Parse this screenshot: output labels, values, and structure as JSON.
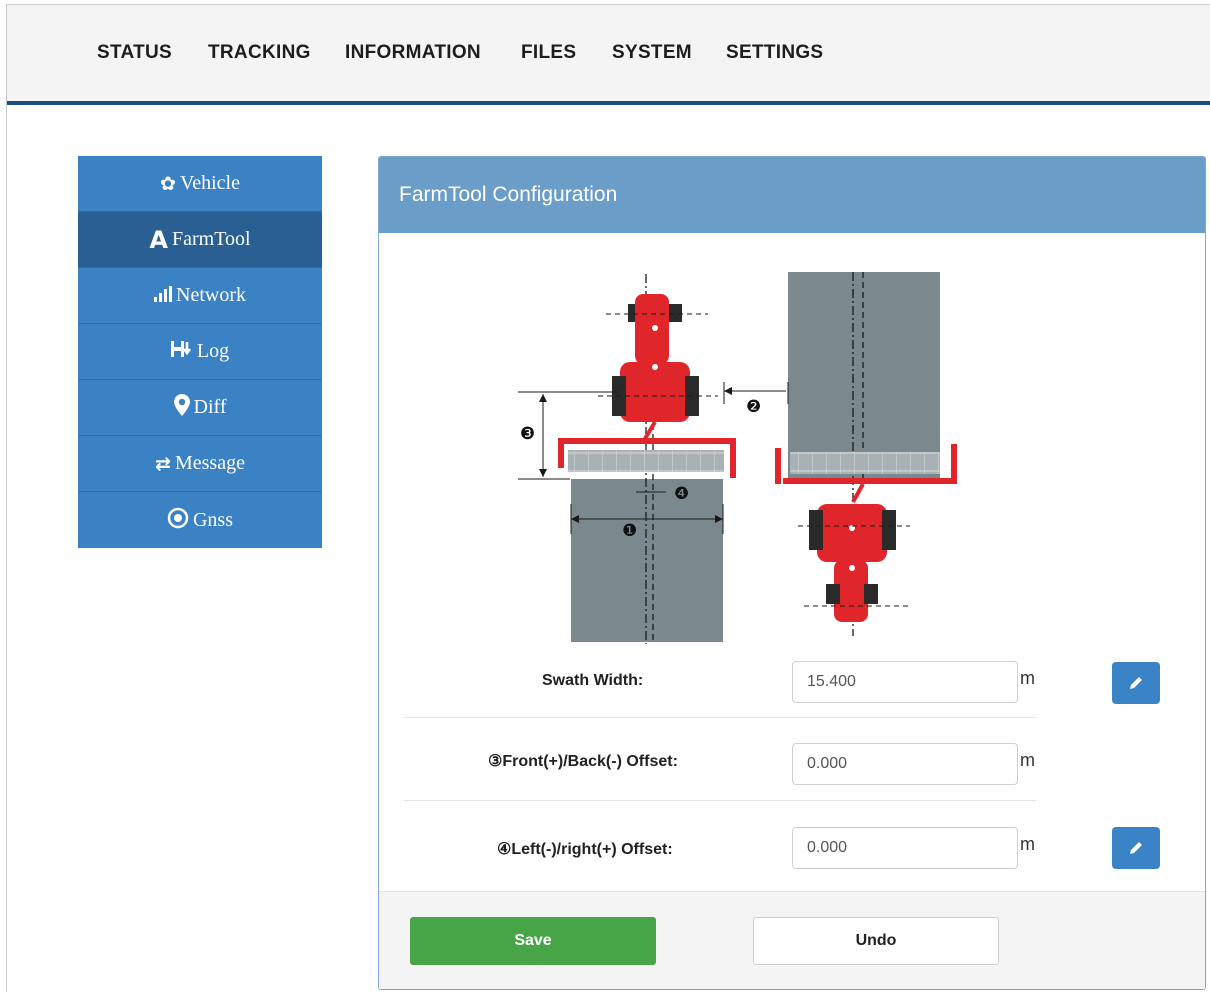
{
  "nav": {
    "items": [
      "STATUS",
      "TRACKING",
      "INFORMATION",
      "FILES",
      "SYSTEM",
      "SETTINGS"
    ]
  },
  "sidebar": {
    "items": [
      {
        "label": "Vehicle",
        "icon": "gear-icon"
      },
      {
        "label": "FarmTool",
        "icon": "road-icon"
      },
      {
        "label": "Network",
        "icon": "signal-icon"
      },
      {
        "label": "Log",
        "icon": "log-icon"
      },
      {
        "label": "Diff",
        "icon": "map-marker-icon"
      },
      {
        "label": "Message",
        "icon": "exchange-icon"
      },
      {
        "label": "Gnss",
        "icon": "target-icon"
      }
    ],
    "active": "FarmTool"
  },
  "panel": {
    "title": "FarmTool Configuration",
    "diagram": {
      "markers": [
        "❶",
        "❷",
        "❸",
        "❹"
      ]
    },
    "fields": [
      {
        "label": "Swath Width:",
        "value": "15.400",
        "unit": "m",
        "editable": true
      },
      {
        "label": "③Front(+)/Back(-) Offset:",
        "value": "0.000",
        "unit": "m",
        "editable": false
      },
      {
        "label": "④Left(-)/right(+) Offset:",
        "value": "0.000",
        "unit": "m",
        "editable": true
      }
    ],
    "save_label": "Save",
    "undo_label": "Undo"
  },
  "colors": {
    "nav_border": "#1c4e7f",
    "sidebar": "#3b82c5",
    "sidebar_active": "#2a5f93",
    "panel_header": "#6b9dc9",
    "save": "#47a447",
    "edit": "#3a83c6",
    "tractor": "#e0262b"
  }
}
